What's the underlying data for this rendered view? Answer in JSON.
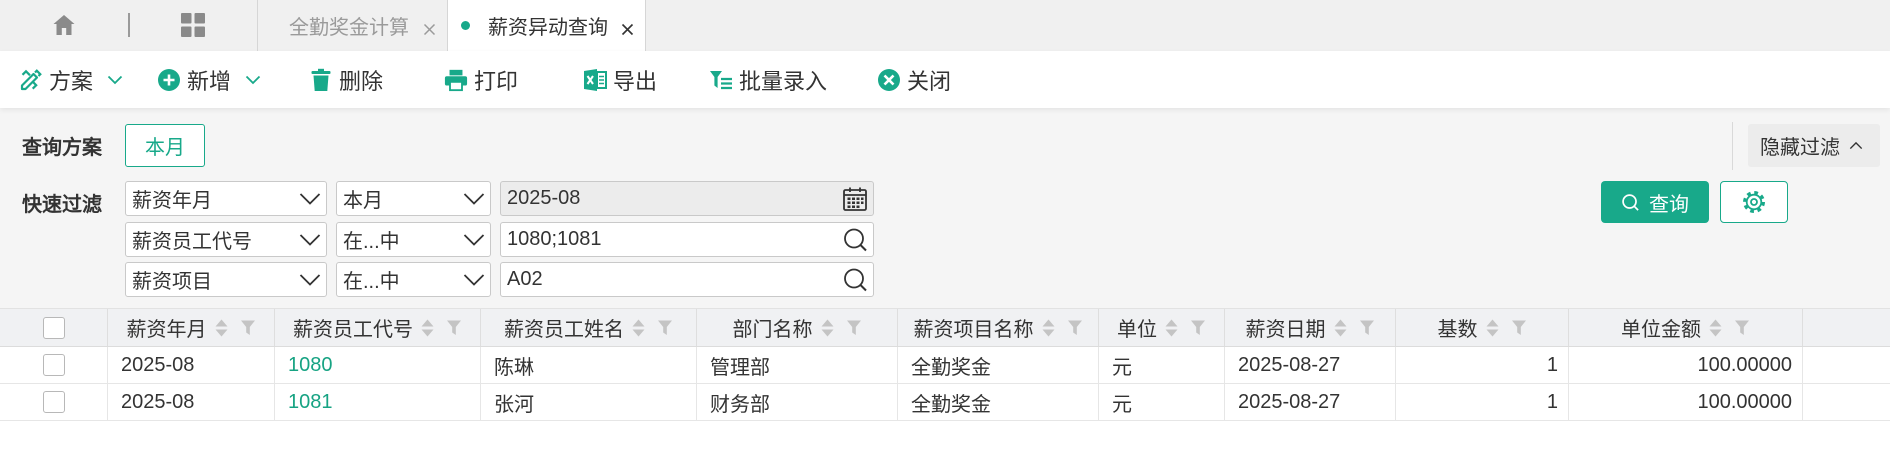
{
  "tabbar": {
    "home_icon": "home-icon",
    "apps_icon": "apps-grid-icon",
    "tabs": [
      {
        "label": "全勤奖金计算",
        "active": false,
        "close_icon": "close-icon"
      },
      {
        "label": "薪资异动查询",
        "active": true,
        "close_icon": "close-icon"
      }
    ]
  },
  "toolbar": {
    "items": [
      {
        "label": "方案",
        "icon": "design-tools-icon",
        "has_dropdown": true
      },
      {
        "label": "新增",
        "icon": "add-circle-icon",
        "has_dropdown": true
      },
      {
        "label": "删除",
        "icon": "trash-icon",
        "has_dropdown": false
      },
      {
        "label": "打印",
        "icon": "printer-icon",
        "has_dropdown": false
      },
      {
        "label": "导出",
        "icon": "excel-export-icon",
        "has_dropdown": false
      },
      {
        "label": "批量录入",
        "icon": "batch-entry-icon",
        "has_dropdown": false
      },
      {
        "label": "关闭",
        "icon": "close-circle-icon",
        "has_dropdown": false
      }
    ]
  },
  "filter": {
    "scheme_label": "查询方案",
    "scheme_button": "本月",
    "hide_filter_label": "隐藏过滤",
    "quick_filter_label": "快速过滤",
    "conditions": [
      {
        "field": "薪资年月",
        "operator": "本月",
        "value": "2025-08",
        "value_icon": "calendar-icon",
        "readonly": true
      },
      {
        "field": "薪资员工代号",
        "operator": "在...中",
        "value": "1080;1081",
        "value_icon": "search-icon",
        "readonly": false
      },
      {
        "field": "薪资项目",
        "operator": "在...中",
        "value": "A02",
        "value_icon": "search-icon",
        "readonly": false
      }
    ],
    "query_button": "查询",
    "query_icon": "search-icon",
    "settings_icon": "gear-icon"
  },
  "table": {
    "columns": [
      "薪资年月",
      "薪资员工代号",
      "薪资员工姓名",
      "部门名称",
      "薪资项目名称",
      "单位",
      "薪资日期",
      "基数",
      "单位金额"
    ],
    "rows": [
      [
        "2025-08",
        "1080",
        "陈琳",
        "管理部",
        "全勤奖金",
        "元",
        "2025-08-27",
        "1",
        "100.00000"
      ],
      [
        "2025-08",
        "1081",
        "张河",
        "财务部",
        "全勤奖金",
        "元",
        "2025-08-27",
        "1",
        "100.00000"
      ]
    ]
  },
  "colors": {
    "accent": "#18a98a",
    "link": "#17a383",
    "text": "#333333",
    "muted_text": "#9a9a9a",
    "tabbar_bg": "#f0f0f0",
    "filter_bg": "#f5f5f5",
    "table_header_bg": "#f0f1f3"
  }
}
